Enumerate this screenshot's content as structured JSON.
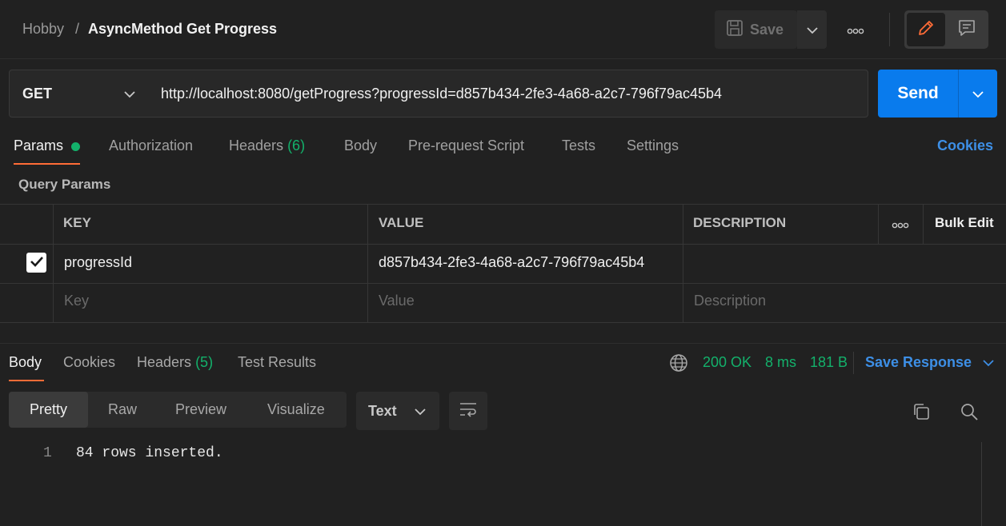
{
  "breadcrumb": {
    "parent": "Hobby",
    "separator": "/",
    "current": "AsyncMethod Get Progress"
  },
  "toolbar": {
    "save_label": "Save"
  },
  "request": {
    "method": "GET",
    "url": "http://localhost:8080/getProgress?progressId=d857b434-2fe3-4a68-a2c7-796f79ac45b4",
    "send_label": "Send"
  },
  "request_tabs": {
    "params": "Params",
    "authorization": "Authorization",
    "headers": "Headers",
    "headers_count": "(6)",
    "body": "Body",
    "prerequest": "Pre-request Script",
    "tests": "Tests",
    "settings": "Settings",
    "cookies": "Cookies"
  },
  "query_params": {
    "title": "Query Params",
    "columns": {
      "key": "KEY",
      "value": "VALUE",
      "description": "DESCRIPTION",
      "bulk_edit": "Bulk Edit"
    },
    "rows": [
      {
        "key": "progressId",
        "value": "d857b434-2fe3-4a68-a2c7-796f79ac45b4",
        "description": "",
        "checked": true
      }
    ],
    "placeholders": {
      "key": "Key",
      "value": "Value",
      "description": "Description"
    }
  },
  "response_tabs": {
    "body": "Body",
    "cookies": "Cookies",
    "headers": "Headers",
    "headers_count": "(5)",
    "test_results": "Test Results"
  },
  "response_meta": {
    "status": "200 OK",
    "time": "8 ms",
    "size": "181 B",
    "save_response": "Save Response"
  },
  "view_modes": {
    "pretty": "Pretty",
    "raw": "Raw",
    "preview": "Preview",
    "visualize": "Visualize"
  },
  "format": "Text",
  "response_body": {
    "line_number": "1",
    "line_text": "84 rows inserted."
  },
  "colors": {
    "accent": "#ff6c37",
    "send": "#097bed",
    "link": "#3d8fe6",
    "success": "#13b16b"
  }
}
